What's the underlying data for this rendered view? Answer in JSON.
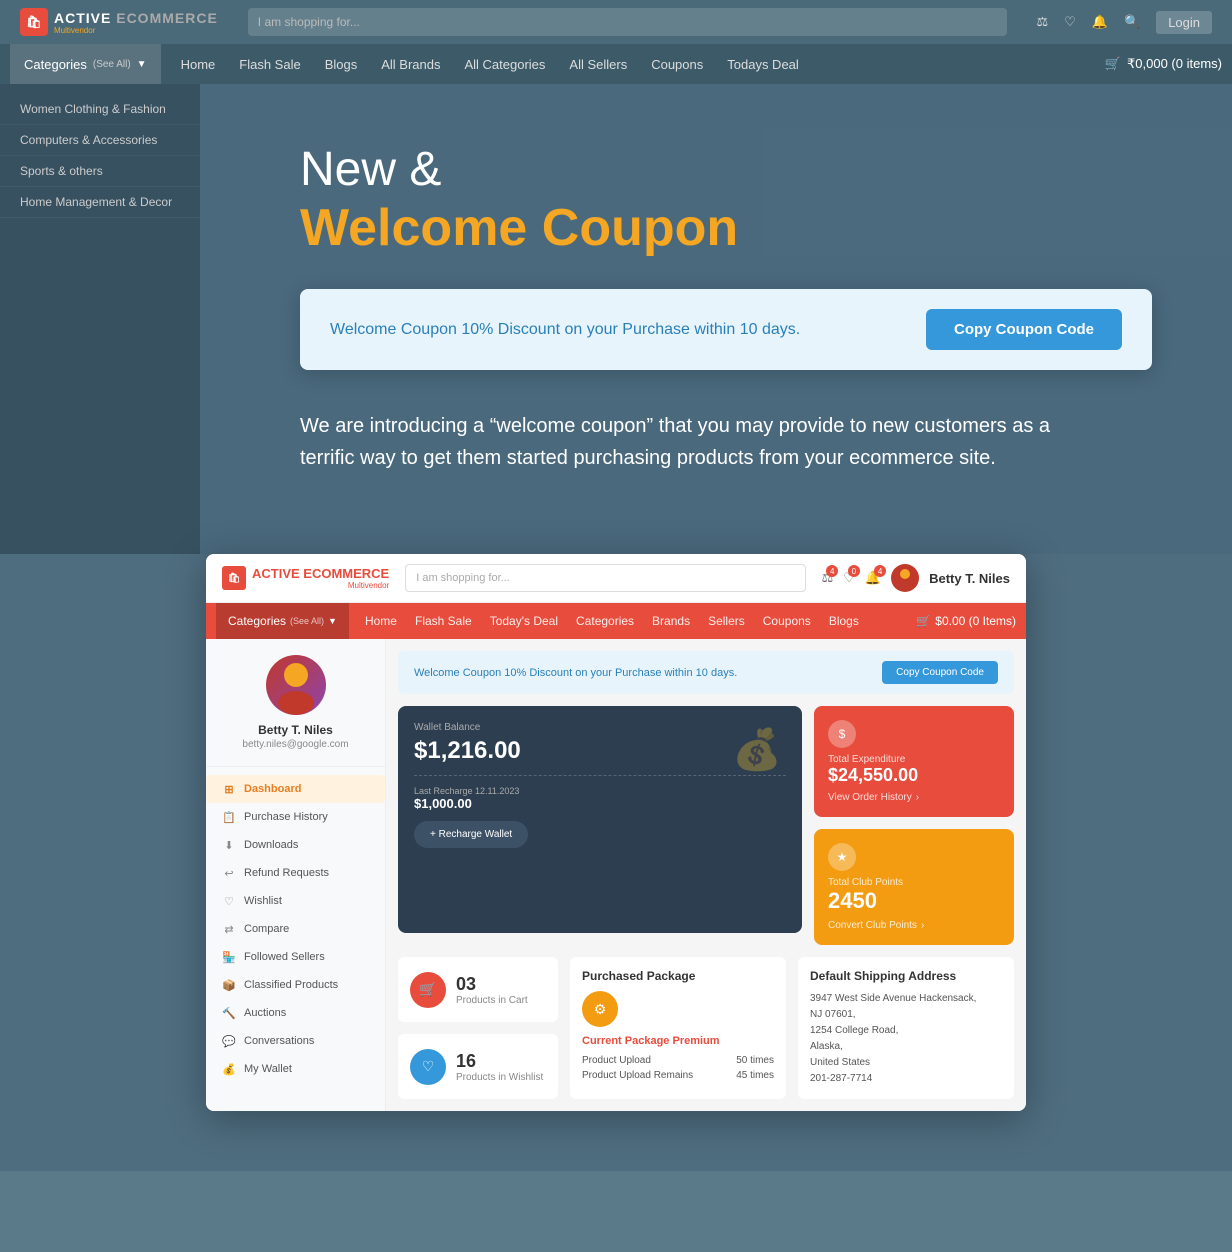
{
  "site": {
    "logo_icon": "🛍",
    "logo_text_active": "ACTIVE",
    "logo_text_ecommerce": " ECOMMERCE",
    "logo_subtitle": "Multivendor",
    "search_placeholder": "I am shopping for..."
  },
  "top_nav": {
    "search_placeholder": "I am shopping for...",
    "login_label": "Login",
    "nav_links": [
      "Home",
      "Flash Sale",
      "Blogs",
      "All Brands",
      "All Categories",
      "All Sellers",
      "Coupons",
      "Todays Deal"
    ],
    "cart_label": "₹0,000 (0 items)"
  },
  "categories_sidebar": {
    "items": [
      "Women Clothing & Fashion",
      "Computers & Accessories",
      "Sports & others",
      "Home Management & Decor"
    ]
  },
  "hero": {
    "title_line1": "New &",
    "title_line2": "Welcome Coupon"
  },
  "coupon_banner": {
    "text": "Welcome Coupon 10% Discount on your Purchase within 10 days.",
    "button_label": "Copy Coupon Code"
  },
  "hero_description": "We are introducing a “welcome coupon” that you may provide to new customers as a terrific way to get them started purchasing products from your ecommerce site.",
  "inner_app": {
    "header": {
      "search_placeholder": "I am shopping for...",
      "user_name": "Betty T. Niles",
      "nav_links": [
        "Home",
        "Flash Sale",
        "Today's Deal",
        "Categories",
        "Brands",
        "Sellers",
        "Coupons",
        "Blogs"
      ],
      "cart_label": "$0.00 (0 Items)"
    },
    "coupon_banner": {
      "text": "Welcome Coupon 10% Discount on your Purchase within 10 days.",
      "button_label": "Copy Coupon Code"
    },
    "sidebar": {
      "profile_name": "Betty T. Niles",
      "profile_email": "betty.niles@google.com",
      "menu_items": [
        {
          "label": "Dashboard",
          "icon": "⊞",
          "active": true
        },
        {
          "label": "Purchase History",
          "icon": "📋",
          "active": false
        },
        {
          "label": "Downloads",
          "icon": "⬇",
          "active": false
        },
        {
          "label": "Refund Requests",
          "icon": "↩",
          "active": false
        },
        {
          "label": "Wishlist",
          "icon": "♡",
          "active": false
        },
        {
          "label": "Compare",
          "icon": "⇄",
          "active": false
        },
        {
          "label": "Followed Sellers",
          "icon": "🏪",
          "active": false
        },
        {
          "label": "Classified Products",
          "icon": "📦",
          "active": false
        },
        {
          "label": "Auctions",
          "icon": "🔨",
          "active": false
        },
        {
          "label": "Conversations",
          "icon": "💬",
          "active": false
        },
        {
          "label": "My Wallet",
          "icon": "💰",
          "active": false
        }
      ]
    },
    "wallet": {
      "label": "Wallet Balance",
      "balance": "$1,216.00",
      "recharge_label": "Last Recharge  12.11.2023",
      "recharge_amount": "$1,000.00",
      "recharge_button": "+ Recharge Wallet"
    },
    "expenditure": {
      "label": "Total Expenditure",
      "amount": "$24,550.00",
      "link_label": "View Order History"
    },
    "club_points": {
      "label": "Total Club Points",
      "points": "2450",
      "link_label": "Convert Club Points"
    },
    "stats": [
      {
        "number": "03",
        "label": "Products in Cart",
        "color": "red"
      },
      {
        "number": "16",
        "label": "Products in Wishlist",
        "color": "blue"
      }
    ],
    "package": {
      "title": "Purchased Package",
      "name": "Current Package Premium",
      "rows": [
        {
          "label": "Product Upload",
          "value": "50 times"
        },
        {
          "label": "Product Upload Remains",
          "value": "45 times"
        }
      ]
    },
    "shipping": {
      "title": "Default Shipping Address",
      "address": "3947 West Side Avenue Hackensack, NJ 07601,\n1254 College Road,\nAlaska,\nUnited States\n201-287-7714"
    }
  }
}
